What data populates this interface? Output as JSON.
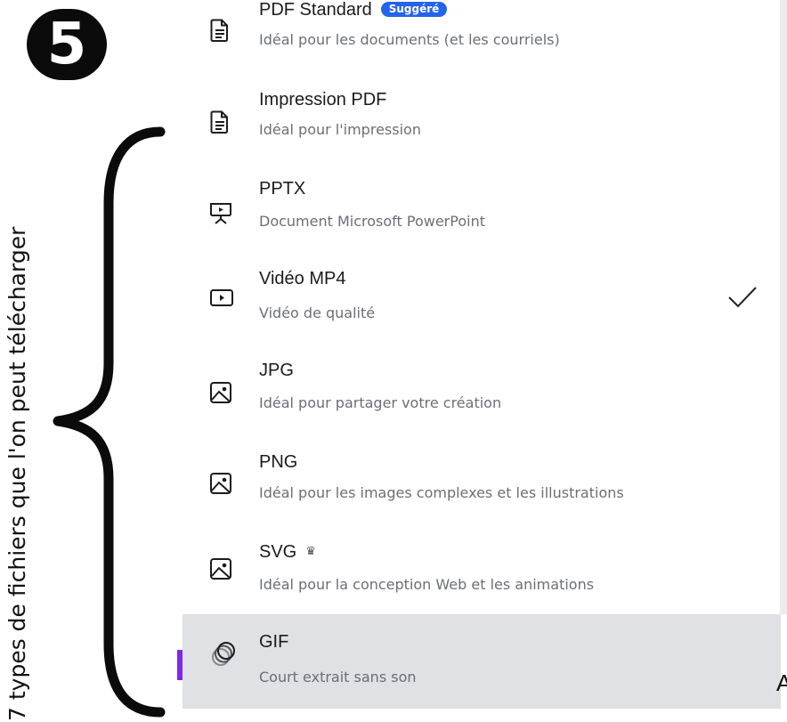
{
  "step": {
    "number": "5"
  },
  "caption": {
    "text": "7 types de fichiers que l'on peut télécharger"
  },
  "download_options": [
    {
      "title": "PDF Standard",
      "badge": "Suggéré",
      "description": "Idéal pour les documents (et les courriels)",
      "icon": "document-icon"
    },
    {
      "title": "Impression PDF",
      "description": "Idéal pour l'impression",
      "icon": "document-icon"
    },
    {
      "title": "PPTX",
      "description": "Document Microsoft PowerPoint",
      "icon": "presentation-icon"
    },
    {
      "title": "Vidéo MP4",
      "description": "Vidéo de qualité",
      "icon": "video-icon",
      "selected": true
    },
    {
      "title": "JPG",
      "description": "Idéal pour partager votre création",
      "icon": "image-icon"
    },
    {
      "title": "PNG",
      "description": "Idéal pour les images complexes et les illustrations",
      "icon": "image-icon"
    },
    {
      "title": "SVG",
      "description": "Idéal pour la conception Web et les animations",
      "icon": "image-icon",
      "premium_icon": "crown-icon"
    },
    {
      "title": "GIF",
      "description": "Court extrait sans son",
      "icon": "gif-icon",
      "hovered": true
    }
  ],
  "partial_text": {
    "right_edge_letter": "A"
  },
  "colors": {
    "badge_blue": "#2563eb",
    "hover_gray": "#dfe1e5",
    "brand_purple": "#7d2ae8"
  }
}
